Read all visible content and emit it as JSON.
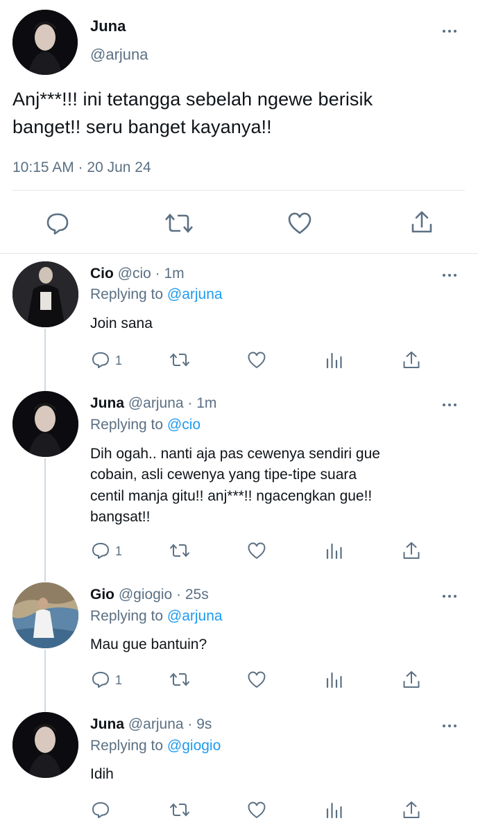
{
  "main_tweet": {
    "name": "Juna",
    "handle": "@arjuna",
    "text_line1": "Anj***!!! ini tetangga sebelah ngewe berisik",
    "text_line2": "banget!! seru banget kayanya!!",
    "timestamp": "10:15 AM · 20 Jun 24",
    "actions": [
      "reply-icon",
      "retweet-icon",
      "like-icon",
      "share-icon"
    ]
  },
  "replies": [
    {
      "name": "Cio",
      "handle_time": "@cio · 1m",
      "replying_prefix": "Replying to",
      "replying_to": "@arjuna",
      "lines": [
        "Join sana"
      ],
      "reply_count": "1"
    },
    {
      "name": "Juna",
      "handle_time": "@arjuna · 1m",
      "replying_prefix": "Replying to",
      "replying_to": "@cio",
      "lines": [
        "Dih ogah.. nanti aja pas cewenya sendiri gue",
        "cobain, asli cewenya yang tipe-tipe suara",
        "centil manja gitu!! anj***!! ngacengkan gue!!",
        "bangsat!!"
      ],
      "reply_count": "1"
    },
    {
      "name": "Gio",
      "handle_time": "@giogio · 25s",
      "replying_prefix": "Replying to",
      "replying_to": "@arjuna",
      "lines": [
        "Mau gue bantuin?"
      ],
      "reply_count": "1"
    },
    {
      "name": "Juna",
      "handle_time": "@arjuna · 9s",
      "replying_prefix": "Replying to",
      "replying_to": "@giogio",
      "lines": [
        "Idih"
      ],
      "reply_count": ""
    }
  ],
  "colors": {
    "text": "#0f1419",
    "muted": "#5b7083",
    "link": "#1d9bf0",
    "divider": "#e1e8ed"
  }
}
